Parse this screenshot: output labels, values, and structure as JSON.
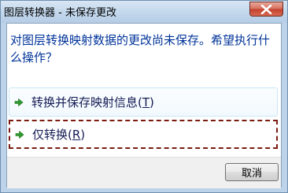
{
  "window": {
    "title": "图层转换器 - 未保存更改"
  },
  "dialog": {
    "main_instruction": "对图层转换映射数据的更改尚未保存。希望执行什么操作？",
    "options": [
      {
        "label_prefix": "转换并保存映射信息(",
        "mnemonic": "T",
        "label_suffix": ")"
      },
      {
        "label_prefix": "仅转换(",
        "mnemonic": "R",
        "label_suffix": ")"
      }
    ],
    "cancel_label": "取消"
  },
  "colors": {
    "instruction": "#003399",
    "link_text": "#151c55",
    "arrow": "#2f9a2f",
    "close_button": "#c4402c"
  },
  "icons": {
    "option_icon": "green-arrow-right-icon",
    "close": "close-icon"
  }
}
